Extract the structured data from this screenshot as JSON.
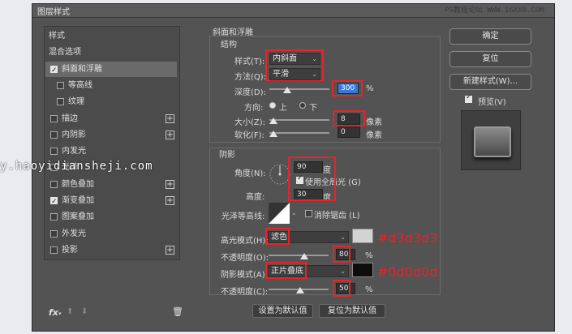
{
  "window": {
    "title": "图层样式",
    "site_watermark": "PS教程论坛 WWW.16XX8.COM",
    "overlay_watermark": "y.haoyidiansheji.com"
  },
  "sidebar": {
    "items": [
      {
        "label": "样式",
        "checkbox": false,
        "checked": false,
        "plus": false,
        "selected": false,
        "indent": false
      },
      {
        "label": "混合选项",
        "checkbox": false,
        "checked": false,
        "plus": false,
        "selected": false,
        "indent": false
      },
      {
        "label": "斜面和浮雕",
        "checkbox": true,
        "checked": true,
        "plus": false,
        "selected": true,
        "indent": false
      },
      {
        "label": "等高线",
        "checkbox": true,
        "checked": false,
        "plus": false,
        "selected": false,
        "indent": true
      },
      {
        "label": "纹理",
        "checkbox": true,
        "checked": false,
        "plus": false,
        "selected": false,
        "indent": true
      },
      {
        "label": "描边",
        "checkbox": true,
        "checked": false,
        "plus": true,
        "selected": false,
        "indent": false
      },
      {
        "label": "内阴影",
        "checkbox": true,
        "checked": false,
        "plus": true,
        "selected": false,
        "indent": false
      },
      {
        "label": "内发光",
        "checkbox": true,
        "checked": false,
        "plus": false,
        "selected": false,
        "indent": false
      },
      {
        "label": "光泽",
        "checkbox": true,
        "checked": false,
        "plus": false,
        "selected": false,
        "indent": false
      },
      {
        "label": "颜色叠加",
        "checkbox": true,
        "checked": false,
        "plus": true,
        "selected": false,
        "indent": false
      },
      {
        "label": "渐变叠加",
        "checkbox": true,
        "checked": true,
        "plus": true,
        "selected": false,
        "indent": false
      },
      {
        "label": "图案叠加",
        "checkbox": true,
        "checked": false,
        "plus": false,
        "selected": false,
        "indent": false
      },
      {
        "label": "外发光",
        "checkbox": true,
        "checked": false,
        "plus": false,
        "selected": false,
        "indent": false
      },
      {
        "label": "投影",
        "checkbox": true,
        "checked": false,
        "plus": true,
        "selected": false,
        "indent": false
      }
    ],
    "fx_label": "fx"
  },
  "bevel": {
    "section_title": "斜面和浮雕",
    "structure_title": "结构",
    "style_label": "样式(T):",
    "style_value": "内斜面",
    "method_label": "方法(Q):",
    "method_value": "平滑",
    "depth_label": "深度(D):",
    "depth_value": "300",
    "depth_unit": "%",
    "direction_label": "方向:",
    "dir_up": "上",
    "dir_down": "下",
    "size_label": "大小(Z):",
    "size_value": "8",
    "size_unit": "像素",
    "soften_label": "软化(F):",
    "soften_value": "0",
    "soften_unit": "像素"
  },
  "shading": {
    "title": "阴影",
    "angle_label": "角度(N):",
    "angle_value": "90",
    "angle_unit": "度",
    "global_light_label": "使用全局光 (G)",
    "altitude_label": "高度:",
    "altitude_value": "30",
    "altitude_unit": "度",
    "gloss_label": "光泽等高线:",
    "antialias_label": "消除锯齿 (L)",
    "highlight_label": "高光模式(H):",
    "highlight_value": "滤色",
    "highlight_color": "#d3d3d3",
    "highlight_annot": "#d3d3d3",
    "hl_opacity_label": "不透明度(O):",
    "hl_opacity_value": "80",
    "pct": "%",
    "shadow_label": "阴影模式(A):",
    "shadow_value": "正片叠底",
    "shadow_color": "#0d0d0d",
    "shadow_annot": "#0d0d0d",
    "sh_opacity_label": "不透明度(C):",
    "sh_opacity_value": "50",
    "default_btn": "设置为默认值",
    "reset_btn": "复位为默认值"
  },
  "buttons": {
    "ok": "确定",
    "reset": "复位",
    "new_style": "新建样式(W)...",
    "preview": "预览(V)"
  },
  "colors": {
    "annot": "#e8232a",
    "highlight": "#d3d3d3",
    "shadow": "#0d0d0d",
    "selection": "#3a78d8"
  }
}
